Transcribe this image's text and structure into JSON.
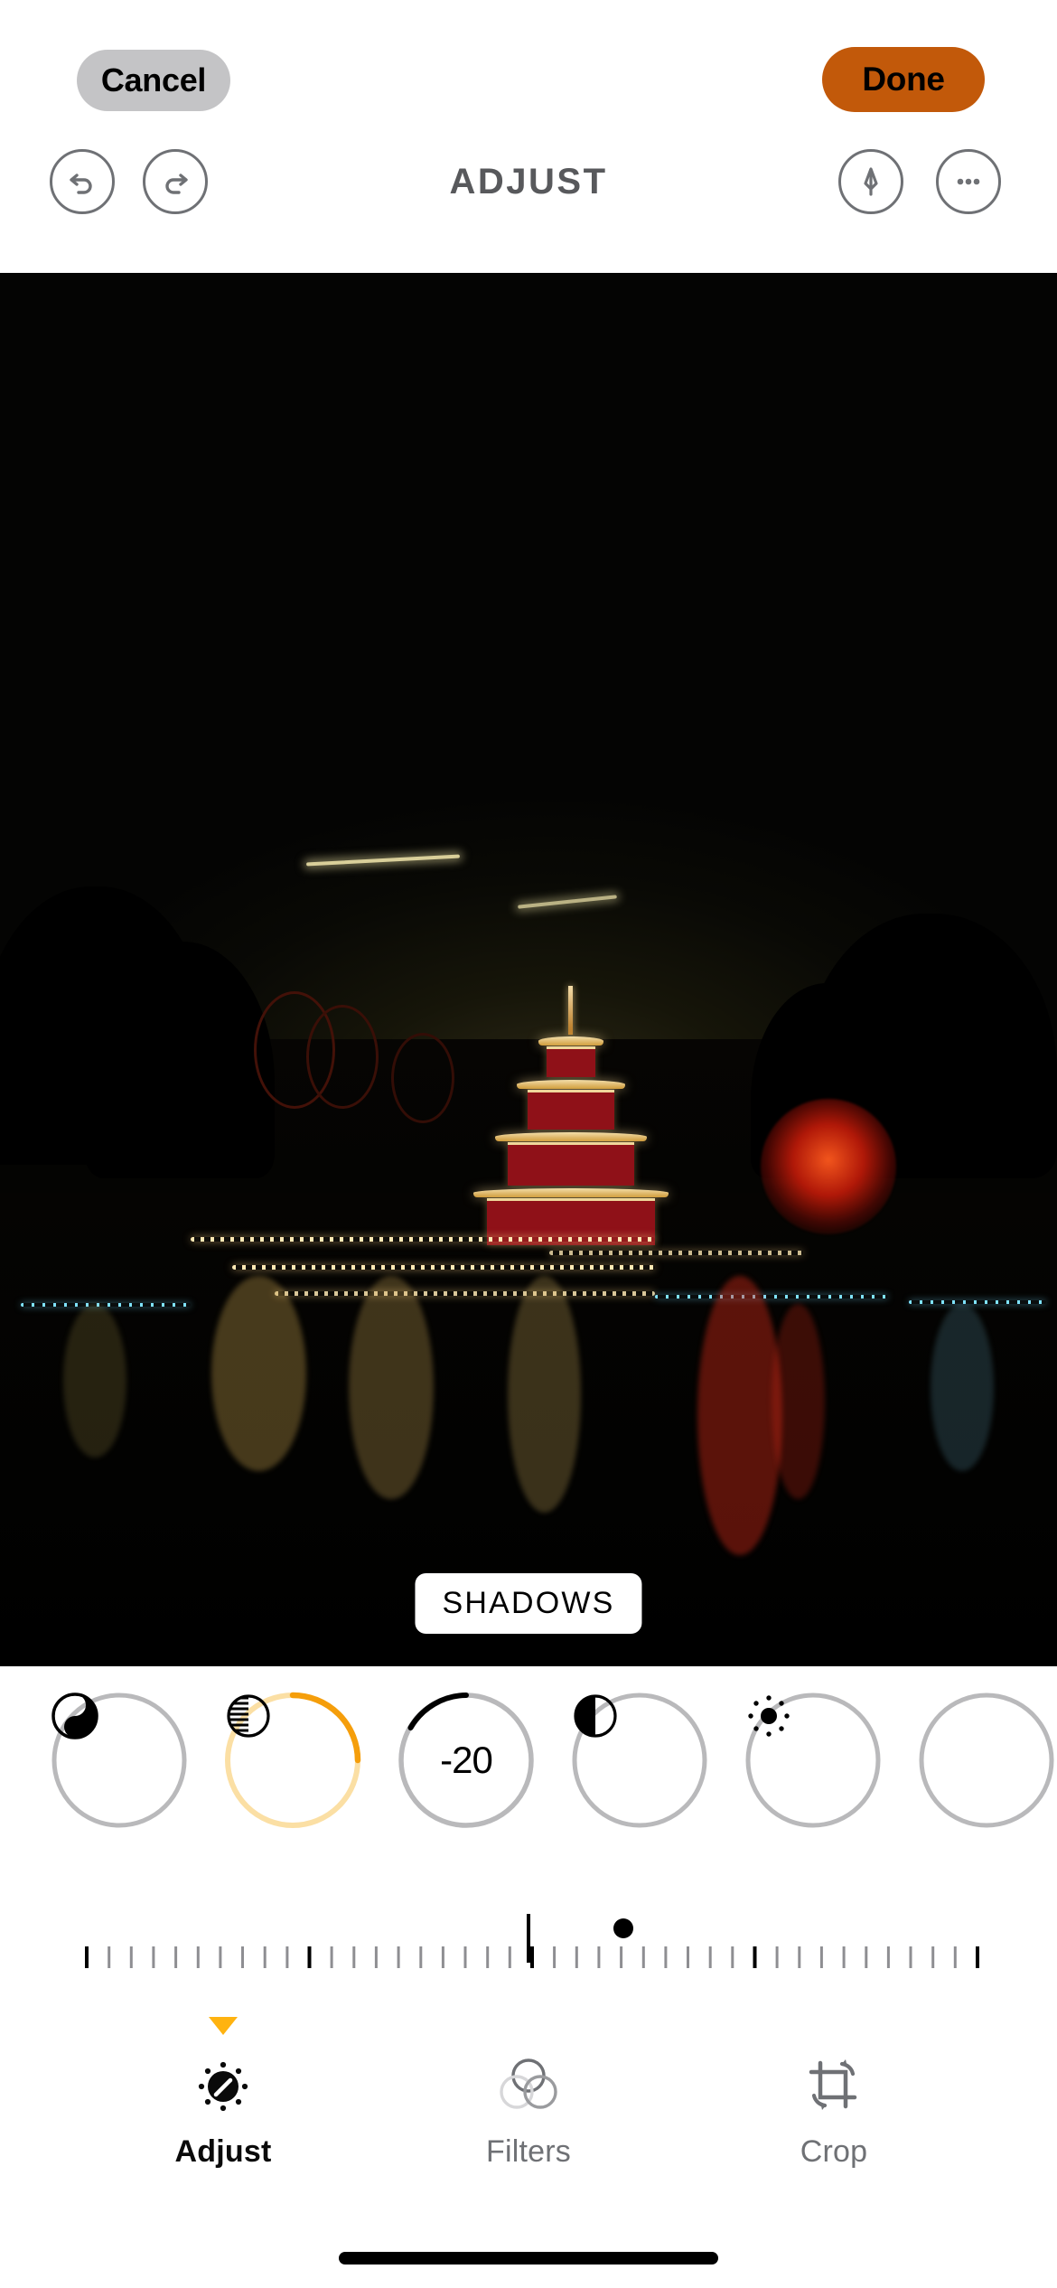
{
  "app": {
    "screen_title": "ADJUST"
  },
  "top_bar": {
    "cancel_label": "Cancel",
    "done_label": "Done",
    "done_color": "#c2590a",
    "cancel_bg": "#c4c4c6"
  },
  "tool_bar": {
    "undo": "undo-icon",
    "redo": "redo-icon",
    "markup": "markup-pen-icon",
    "more": "more-ellipsis-icon",
    "icon_color": "#6f7175"
  },
  "photo": {
    "overlay_badge": "SHADOWS",
    "description": "Night view of an illuminated pagoda and light displays reflected in a lake at an amusement park"
  },
  "adjust_dials": [
    {
      "name": "Brilliance",
      "icon": "brilliance-icon",
      "value": "",
      "progress": 0,
      "active": false,
      "track_color": "#b9b9bb"
    },
    {
      "name": "Shadows",
      "icon": "shadows-icon",
      "value": "",
      "progress": 25,
      "active": true,
      "track_color": "#fbdfa4",
      "fill_color": "#f59e0b"
    },
    {
      "name": "Exposure",
      "icon": "value-dial",
      "value": "-20",
      "progress": -22,
      "active": false,
      "track_color": "#b9b9bb",
      "fill_color": "#000000"
    },
    {
      "name": "Contrast",
      "icon": "contrast-icon",
      "value": "",
      "progress": 0,
      "active": false,
      "track_color": "#b9b9bb"
    },
    {
      "name": "Brightness",
      "icon": "brightness-icon",
      "value": "",
      "progress": 0,
      "active": false,
      "track_color": "#b9b9bb"
    }
  ],
  "slider": {
    "value": -20,
    "min": -100,
    "max": 100,
    "center_marker": true,
    "thumb_position_pct": 46,
    "tick_count": 41
  },
  "tabs": [
    {
      "label": "Adjust",
      "icon": "adjust-dial-icon",
      "active": true
    },
    {
      "label": "Filters",
      "icon": "filters-circles-icon",
      "active": false
    },
    {
      "label": "Crop",
      "icon": "crop-rotate-icon",
      "active": false
    }
  ],
  "accent": {
    "orange": "#ffb310",
    "dial_orange": "#f59e0b",
    "done_orange": "#c2590a"
  },
  "home_indicator": true
}
